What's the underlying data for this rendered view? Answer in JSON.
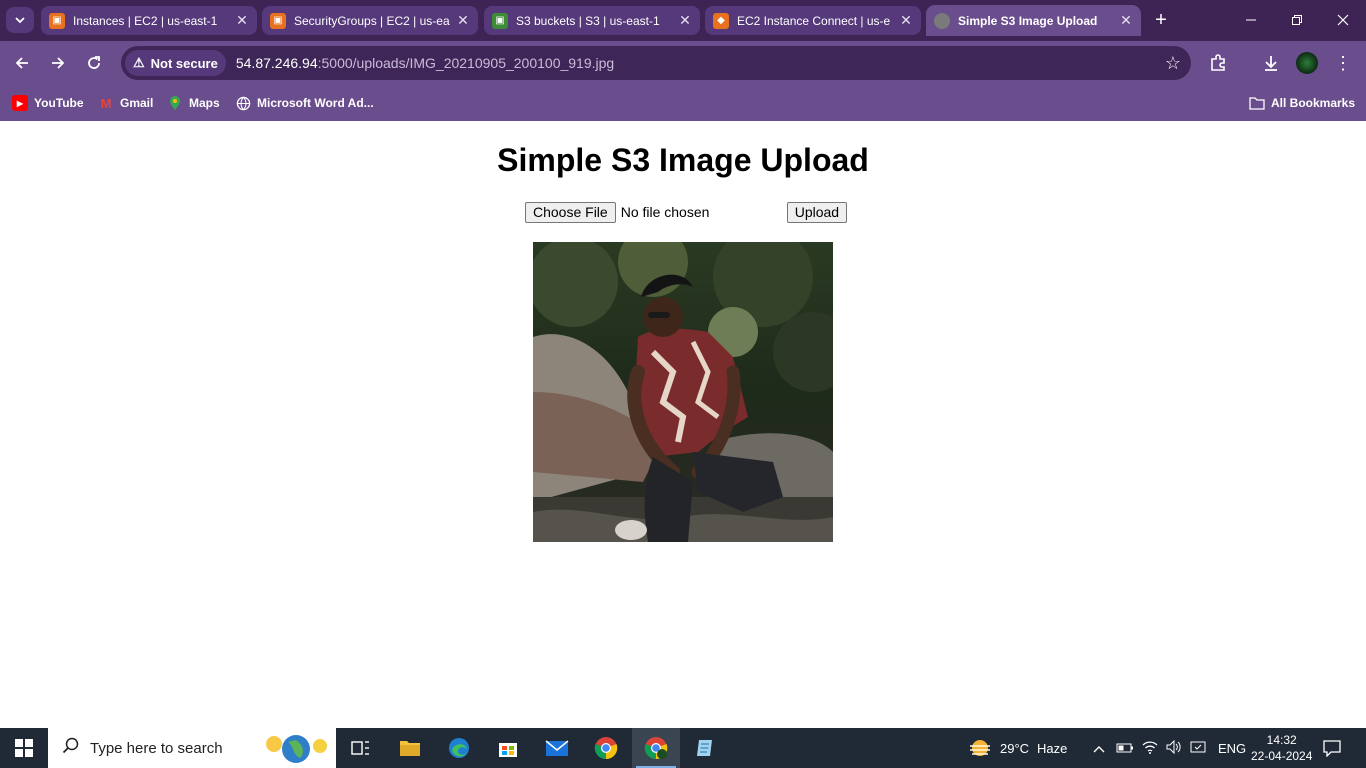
{
  "browser": {
    "tabs": [
      {
        "title": "Instances | EC2 | us-east-1",
        "icon": "aws-ec2-icon",
        "color": "#e8711f"
      },
      {
        "title": "SecurityGroups | EC2 | us-ea",
        "icon": "aws-ec2-icon",
        "color": "#e8711f"
      },
      {
        "title": "S3 buckets | S3 | us-east-1",
        "icon": "aws-s3-icon",
        "color": "#3d8b37"
      },
      {
        "title": "EC2 Instance Connect | us-e",
        "icon": "aws-cube-icon",
        "color": "#e8711f"
      },
      {
        "title": "Simple S3 Image Upload",
        "icon": "globe-icon",
        "color": "#888888"
      }
    ],
    "security_label": "Not secure",
    "url_host": "54.87.246.94",
    "url_path": ":5000/uploads/IMG_20210905_200100_919.jpg",
    "bookmarks": [
      {
        "label": "YouTube",
        "icon": "youtube-icon"
      },
      {
        "label": "Gmail",
        "icon": "gmail-icon"
      },
      {
        "label": "Maps",
        "icon": "maps-icon"
      },
      {
        "label": "Microsoft Word Ad...",
        "icon": "globe-icon"
      }
    ],
    "all_bookmarks": "All Bookmarks"
  },
  "page": {
    "title": "Simple S3 Image Upload",
    "choose_file_label": "Choose File",
    "no_file_text": "No file chosen",
    "upload_label": "Upload",
    "image_alt": "uploaded photo"
  },
  "taskbar": {
    "search_placeholder": "Type here to search",
    "weather_temp": "29°C",
    "weather_desc": "Haze",
    "language": "ENG",
    "time": "14:32",
    "date": "22-04-2024"
  },
  "colors": {
    "tabstrip": "#3d2455",
    "toolbar": "#6a4d8c",
    "taskbar": "#202a36"
  }
}
